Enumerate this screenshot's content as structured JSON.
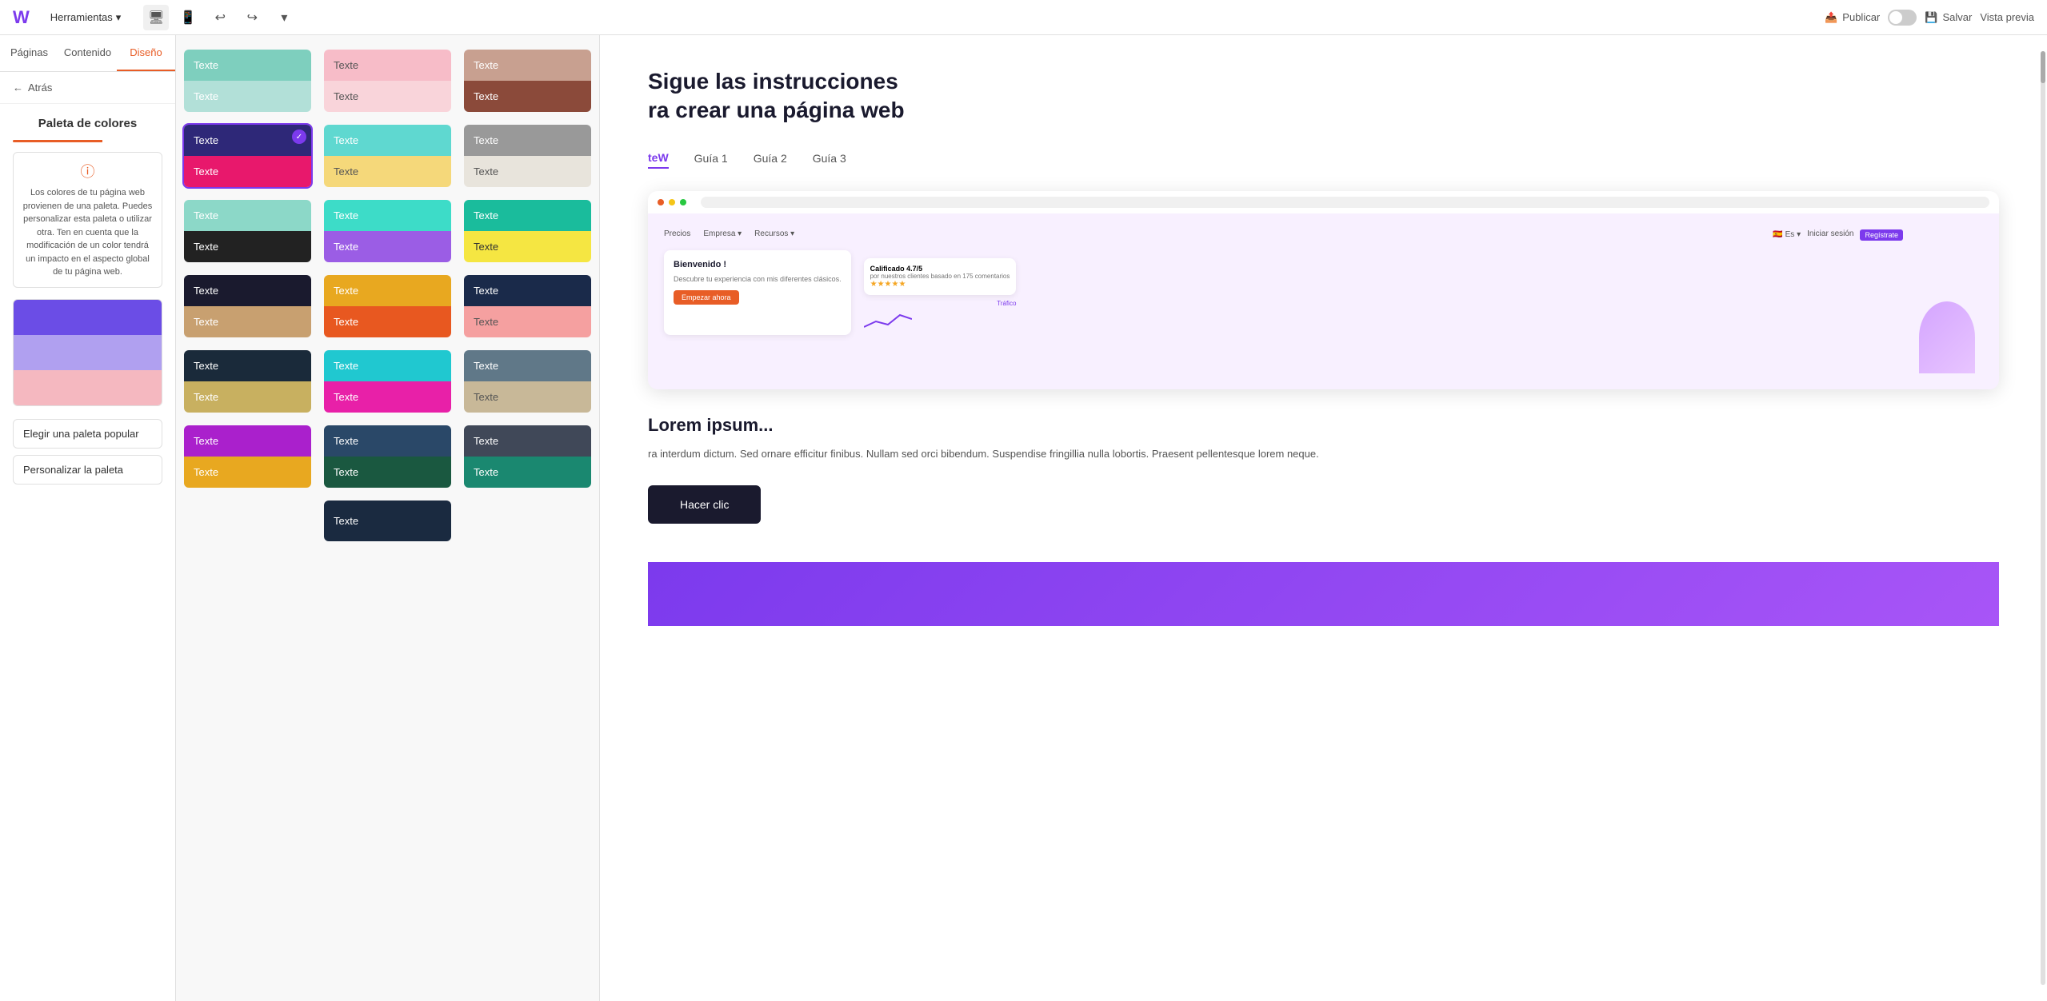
{
  "topbar": {
    "logo": "W",
    "menu_label": "Herramientas",
    "undo_icon": "↩",
    "redo_icon": "↪",
    "more_icon": "▾",
    "desktop_icon": "🖥",
    "mobile_icon": "📱",
    "publish_label": "Publicar",
    "save_label": "Salvar",
    "preview_label": "Vista previa"
  },
  "left_nav": {
    "tabs": [
      "Páginas",
      "Contenido",
      "Diseño"
    ],
    "active_tab": "Diseño",
    "back_label": "Atrás",
    "section_title": "Paleta de colores",
    "info_text": "Los colores de tu página web provienen de una paleta. Puedes personalizar esta paleta o utilizar otra. Ten en cuenta que la modificación de un color tendrá un impacto en el aspecto global de tu página web.",
    "current_palette": {
      "color1": "#6b4de6",
      "color2": "#b0a0f0",
      "color3": "#f5b8c0"
    },
    "btn_popular": "Elegir una paleta popular",
    "btn_customize": "Personalizar la paleta"
  },
  "palette_grid": {
    "cards": [
      {
        "top_bg": "#7ecfbe",
        "bottom_bg": "#b2e0d8",
        "top_color": "#fff",
        "bottom_color": "#fff"
      },
      {
        "top_bg": "#f7bcc8",
        "bottom_bg": "#f9d4da",
        "top_color": "#555",
        "bottom_color": "#555"
      },
      {
        "top_bg": "#c8a090",
        "bottom_bg": "#8b4a3a",
        "top_color": "#fff",
        "bottom_color": "#fff"
      },
      {
        "top_bg": "#2e2878",
        "bottom_bg": "#e8186c",
        "top_color": "#fff",
        "bottom_color": "#fff",
        "selected": true
      },
      {
        "top_bg": "#5fd8d0",
        "bottom_bg": "#f5d87a",
        "top_color": "#fff",
        "bottom_color": "#555"
      },
      {
        "top_bg": "#999999",
        "bottom_bg": "#e8e4dc",
        "top_color": "#fff",
        "bottom_color": "#555"
      },
      {
        "top_bg": "#8cd8c8",
        "bottom_bg": "#222222",
        "top_color": "#fff",
        "bottom_color": "#fff"
      },
      {
        "top_bg": "#3ddcc8",
        "bottom_bg": "#9b5de5",
        "top_color": "#fff",
        "bottom_color": "#fff"
      },
      {
        "top_bg": "#1abc9c",
        "bottom_bg": "#f5e642",
        "top_color": "#fff",
        "bottom_color": "#333"
      },
      {
        "top_bg": "#1a1a2e",
        "bottom_bg": "#c8a070",
        "top_color": "#fff",
        "bottom_color": "#fff",
        "selected2": true
      },
      {
        "top_bg": "#e8a820",
        "bottom_bg": "#e85820",
        "top_color": "#fff",
        "bottom_color": "#fff"
      },
      {
        "top_bg": "#1a2a4a",
        "bottom_bg": "#f5a0a0",
        "top_color": "#fff",
        "bottom_color": "#555"
      },
      {
        "top_bg": "#1a2a3a",
        "bottom_bg": "#c8b060",
        "top_color": "#fff",
        "bottom_color": "#fff"
      },
      {
        "top_bg": "#20c8d0",
        "bottom_bg": "#e820a8",
        "top_color": "#fff",
        "bottom_color": "#fff"
      },
      {
        "top_bg": "#607888",
        "bottom_bg": "#c8b898",
        "top_color": "#fff",
        "bottom_color": "#555"
      },
      {
        "top_bg": "#aa20cc",
        "bottom_bg": "#e8a820",
        "top_color": "#fff",
        "bottom_color": "#fff"
      },
      {
        "top_bg": "#2a4868",
        "bottom_bg": "#1a5840",
        "top_color": "#fff",
        "bottom_color": "#fff"
      },
      {
        "top_bg": "#404858",
        "bottom_bg": "#1a8870",
        "top_color": "#fff",
        "bottom_color": "#fff"
      },
      {
        "top_bg": "#1a2a40",
        "bottom_bg": "#1a2a40",
        "top_color": "#fff",
        "bottom_color": "#fff"
      }
    ],
    "card_label": "Texte"
  },
  "preview": {
    "heading": "Sigue las instrucciones\nra crear una página web",
    "nav_items": [
      "teW",
      "Guía 1",
      "Guía 2",
      "Guía 3"
    ],
    "nav_active": "teW",
    "mini_browser": {
      "nav_items": [
        "Precios",
        "Empresa",
        "Recursos"
      ],
      "card_title": "Bienvenido !",
      "card_desc": "Descubre tu experiencia con mis diferentes clásicos.",
      "card_btn": "Empezar ahora",
      "rating": "Calificado 4.7/5",
      "rating_sub": "por nuestros clientes basado en 175 comentarios",
      "stars": "★★★★★",
      "chart_label": "Tráfico"
    },
    "lorem_title": "Lorem ipsum...",
    "lorem_text": "ra interdum dictum. Sed ornare efficitur finibus. Nullam sed orci bibendum. Suspendise fringillia nulla lobortis. Praesent pellentesque lorem neque.",
    "hacer_clic_label": "Hacer clic",
    "purple_bar_present": true
  }
}
